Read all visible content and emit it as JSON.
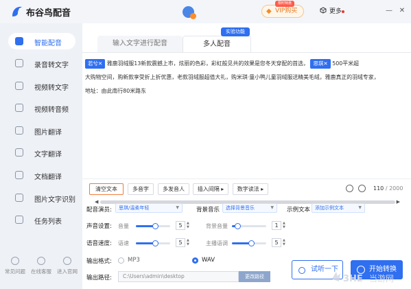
{
  "app": {
    "title": "布谷鸟配音"
  },
  "header": {
    "vip_label": "VIP购买",
    "vip_tag": "限时特惠",
    "more_label": "更多",
    "minimize": "—",
    "close": "✕"
  },
  "sidebar": {
    "items": [
      {
        "label": "智能配音",
        "active": true
      },
      {
        "label": "录音转文字"
      },
      {
        "label": "视频转文字"
      },
      {
        "label": "视频转音频"
      },
      {
        "label": "图片翻译"
      },
      {
        "label": "文字翻译"
      },
      {
        "label": "文档翻译"
      },
      {
        "label": "图片文字识别"
      },
      {
        "label": "任务列表"
      }
    ],
    "footer": [
      "常见问题",
      "在线客服",
      "进入官网"
    ]
  },
  "tabs": {
    "tab1": "输入文字进行配音",
    "tab2": "多人配音",
    "badge": "实验功能"
  },
  "editor": {
    "tag1": "若兮✕",
    "line1_a": "雅鹿羽绒服13新款震撼上市，炫丽的色彩，彩虹般见共的效果是您冬天穿配的首选，",
    "tag2": "思琪✕",
    "line1_b": "500平米超",
    "line2": "大购物空间，购新款享受折上折优惠，老款羽绒服超值大礼，购米琪·童小鸭儿童羽绒服送精美毛绒，雅鹿真正的羽绒专家，",
    "line3": "地址：由此南行80米路东"
  },
  "toolbar": {
    "clear": "清空文本",
    "polyphone": "多音字",
    "polyphone_person": "多发音人",
    "insert_pause": "插入间隔 ▸",
    "number_read": "数字读法 ▸",
    "count": "110",
    "max": " / 2000"
  },
  "settings": {
    "voice_label": "配音演员:",
    "voice_value": "思琪/温柔年轻",
    "bgm_label": "背景音乐",
    "bgm_value": "选择背景音乐",
    "sample_label": "示例文本",
    "sample_value": "添加示例文本",
    "volume_label": "声音设置:",
    "volume_name": "音量",
    "volume_value": "5",
    "bgvol_name": "背景音量",
    "bgvol_value": "1",
    "speed_label": "语音速度:",
    "speed_name": "语速",
    "speed_value": "5",
    "pitch_name": "主播语调",
    "pitch_value": "5",
    "format_label": "输出格式:",
    "format_mp3": "MP3",
    "format_wav": "WAV",
    "path_label": "输出路径:",
    "path_value": "C:\\Users\\admin\\desktop",
    "change_path": "更改路径",
    "trial": "试听一下",
    "start": "开始转换"
  },
  "levels": {
    "volume": 0.55,
    "bg_volume": 0.15,
    "speed": 0.55,
    "pitch": 0.55
  },
  "colors": {
    "accent": "#2f6ff0",
    "highlight": "#f07a3c"
  },
  "icons": [
    "logo-bird-icon",
    "vip-diamond-icon",
    "cube-icon",
    "smart-dub-icon",
    "mic-icon",
    "video-icon",
    "image-icon",
    "text-icon",
    "doc-icon",
    "ocr-icon",
    "list-icon",
    "help-icon",
    "service-icon",
    "home-icon",
    "undo-icon",
    "play-icon",
    "convert-icon"
  ]
}
